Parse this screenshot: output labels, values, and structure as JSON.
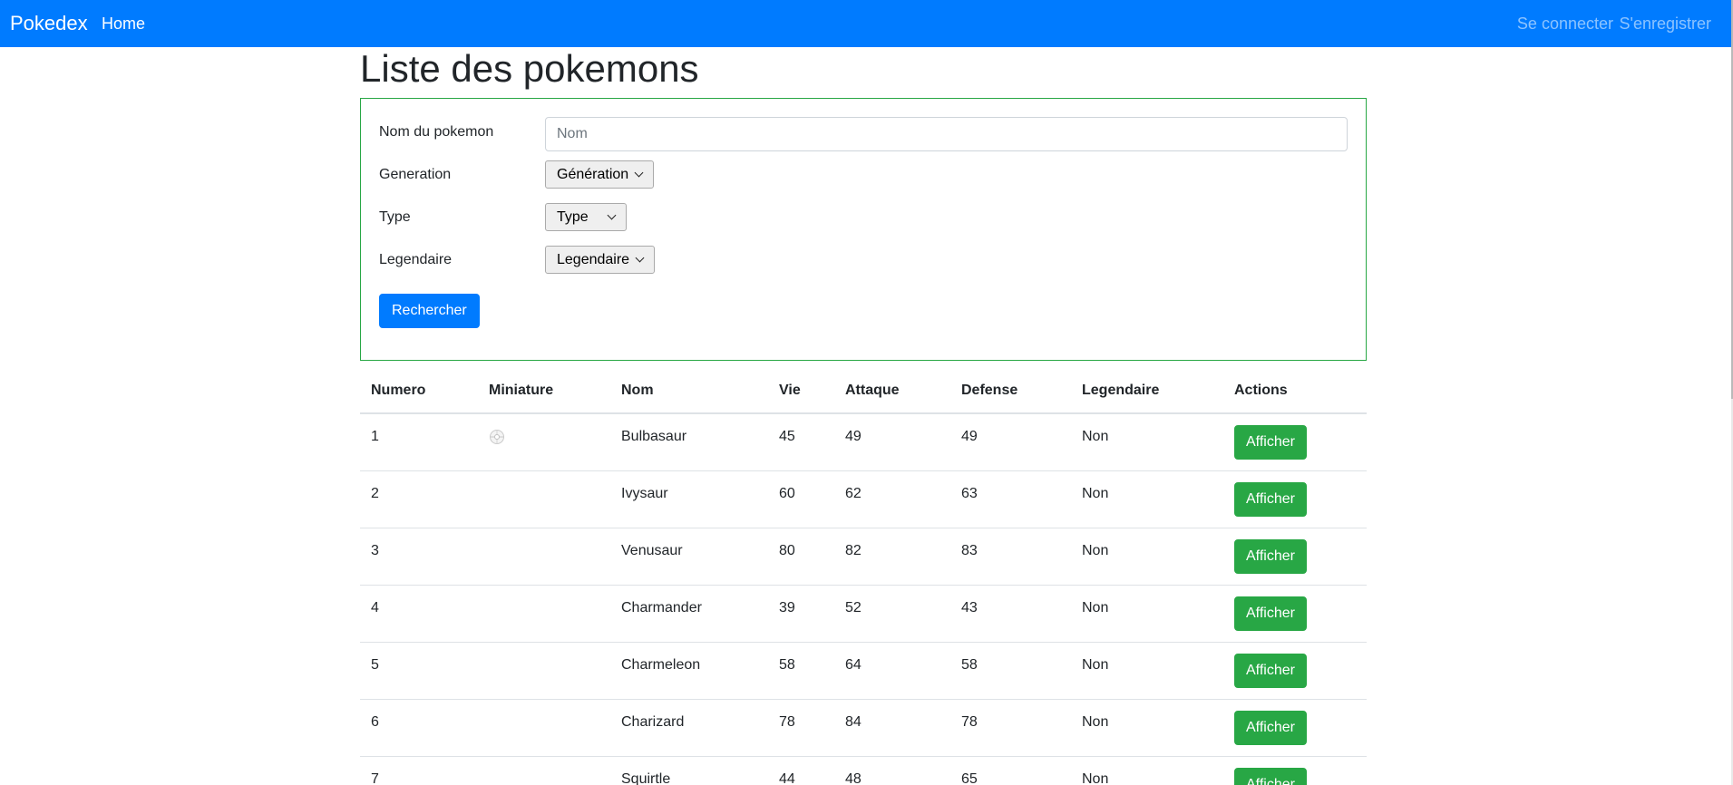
{
  "navbar": {
    "brand": "Pokedex",
    "home": "Home",
    "login": "Se connecter",
    "register": "S'enregistrer",
    "color": "#007bff"
  },
  "page_title": "Liste des pokemons",
  "search": {
    "name_label": "Nom du pokemon",
    "name_placeholder": "Nom",
    "name_value": "",
    "generation_label": "Generation",
    "generation_selected": "Génération",
    "type_label": "Type",
    "type_selected": "Type",
    "legendary_label": "Legendaire",
    "legendary_selected": "Legendaire",
    "submit_label": "Rechercher"
  },
  "table": {
    "headers": [
      "Numero",
      "Miniature",
      "Nom",
      "Vie",
      "Attaque",
      "Defense",
      "Legendaire",
      "Actions"
    ],
    "action_label": "Afficher",
    "rows": [
      {
        "numero": "1",
        "thumbnail": "pokemon-thumbnail-icon",
        "nom": "Bulbasaur",
        "vie": "45",
        "attaque": "49",
        "defense": "49",
        "legendaire": "Non"
      },
      {
        "numero": "2",
        "thumbnail": "",
        "nom": "Ivysaur",
        "vie": "60",
        "attaque": "62",
        "defense": "63",
        "legendaire": "Non"
      },
      {
        "numero": "3",
        "thumbnail": "",
        "nom": "Venusaur",
        "vie": "80",
        "attaque": "82",
        "defense": "83",
        "legendaire": "Non"
      },
      {
        "numero": "4",
        "thumbnail": "",
        "nom": "Charmander",
        "vie": "39",
        "attaque": "52",
        "defense": "43",
        "legendaire": "Non"
      },
      {
        "numero": "5",
        "thumbnail": "",
        "nom": "Charmeleon",
        "vie": "58",
        "attaque": "64",
        "defense": "58",
        "legendaire": "Non"
      },
      {
        "numero": "6",
        "thumbnail": "",
        "nom": "Charizard",
        "vie": "78",
        "attaque": "84",
        "defense": "78",
        "legendaire": "Non"
      },
      {
        "numero": "7",
        "thumbnail": "",
        "nom": "Squirtle",
        "vie": "44",
        "attaque": "48",
        "defense": "65",
        "legendaire": "Non"
      }
    ]
  }
}
